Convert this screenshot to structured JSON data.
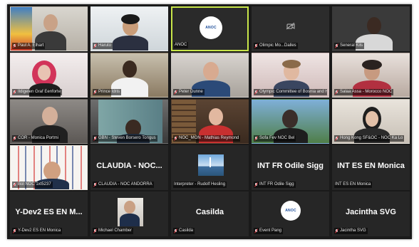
{
  "participants": [
    {
      "label": "Paul A. Elhart",
      "muted": true,
      "kind": "video"
    },
    {
      "label": "Haruto",
      "muted": true,
      "kind": "video"
    },
    {
      "label": "ANOC",
      "muted": false,
      "kind": "logo",
      "logo_text": "ANOC"
    },
    {
      "label": "Olimpic Mo...Dalles",
      "muted": true,
      "kind": "camera-off"
    },
    {
      "label": "Seneral Kils",
      "muted": true,
      "kind": "video"
    },
    {
      "label": "Ildigelen Graf Eenforte",
      "muted": true,
      "kind": "video"
    },
    {
      "label": "Prince Idris",
      "muted": true,
      "kind": "video"
    },
    {
      "label": "Peter Dunne",
      "muted": true,
      "kind": "video"
    },
    {
      "label": "Olympic Committee of Bosnia and H...",
      "muted": true,
      "kind": "video"
    },
    {
      "label": "Salaa Assa - Morocco NOC",
      "muted": true,
      "kind": "video"
    },
    {
      "label": "COR - Monica Portmi",
      "muted": true,
      "kind": "video"
    },
    {
      "label": "GBN - Steven Borsero Tongus",
      "muted": true,
      "kind": "video"
    },
    {
      "label": "NOC_MON - Mathias Reymond",
      "muted": true,
      "kind": "video"
    },
    {
      "label": "Sofa Fev NOC Bel",
      "muted": true,
      "kind": "video"
    },
    {
      "label": "Hong Kong SF&OC - NOC Ka Lo",
      "muted": true,
      "kind": "video"
    },
    {
      "label": "Bol NOC 1xt5237",
      "muted": true,
      "kind": "video"
    },
    {
      "label": "CLAUDIA - NOC ANDORRA",
      "muted": true,
      "kind": "name",
      "display_name": "CLAUDIA - NOC..."
    },
    {
      "label": "Interpreter - Rudolf Hesling",
      "muted": false,
      "kind": "video"
    },
    {
      "label": "INT FR Odile Sigg",
      "muted": true,
      "kind": "name",
      "display_name": "INT FR Odile Sigg"
    },
    {
      "label": "INT ES EN Monica",
      "muted": false,
      "kind": "name",
      "display_name": "INT ES EN Monica"
    },
    {
      "label": "Y-Dev2 ES EN Monica",
      "muted": true,
      "kind": "name",
      "display_name": "Y-Dev2 ES EN M..."
    },
    {
      "label": "Michael Chamber",
      "muted": true,
      "kind": "video"
    },
    {
      "label": "Casilda",
      "muted": true,
      "kind": "name",
      "display_name": "Casilda"
    },
    {
      "label": "Event Pang",
      "muted": true,
      "kind": "logo",
      "logo_text": "ANOC"
    },
    {
      "label": "Jacintha SVG",
      "muted": true,
      "kind": "name",
      "display_name": "Jacintha SVG"
    }
  ],
  "colors": {
    "active_speaker_border": "#c8e64a",
    "mute_red": "#e0303a",
    "tile_bg": "#262626"
  }
}
